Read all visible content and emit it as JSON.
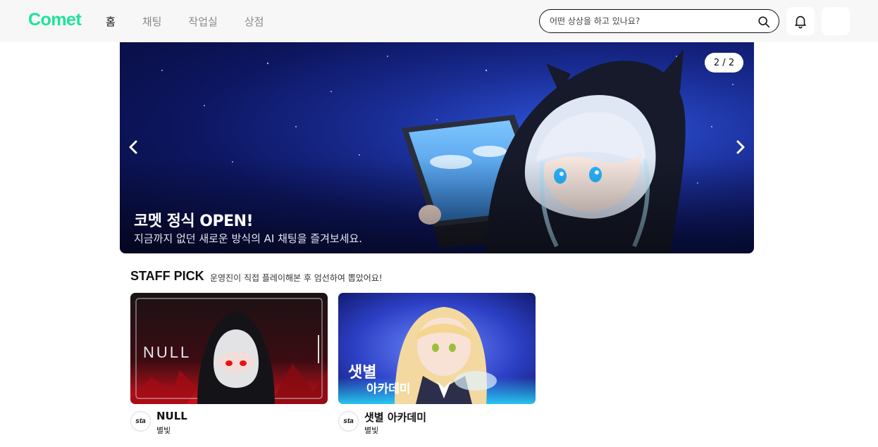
{
  "header": {
    "logo": "Comet",
    "nav": [
      {
        "label": "홈",
        "active": true
      },
      {
        "label": "채팅",
        "active": false
      },
      {
        "label": "작업실",
        "active": false
      },
      {
        "label": "상점",
        "active": false
      }
    ],
    "search": {
      "placeholder": "어떤 상상을 하고 있나요?",
      "value": ""
    },
    "icons": {
      "search": "search-icon",
      "notifications": "bell-icon"
    }
  },
  "banner": {
    "counter": "2 / 2",
    "title": "코멧 정식 OPEN!",
    "subtitle": "지금까지 없던 새로운 방식의 AI 채팅을 즐겨보세요.",
    "prev_icon": "chevron-left-icon",
    "next_icon": "chevron-right-icon"
  },
  "staff_pick": {
    "title": "STAFF PICK",
    "description": "운영진이 직접 플레이해본 후 엄선하여 뽑았어요!",
    "cards": [
      {
        "title": "NULL",
        "author": "별빛",
        "badge": "sta",
        "thumb_text": "NULL"
      },
      {
        "title": "샛별 아카데미",
        "author": "별빛",
        "badge": "sta",
        "thumb_text_1": "샛별",
        "thumb_text_2": "아카데미"
      }
    ]
  },
  "colors": {
    "brand": "#1fe39a",
    "header_bg": "#f7f7f7",
    "banner_bg": "#0d1660"
  }
}
